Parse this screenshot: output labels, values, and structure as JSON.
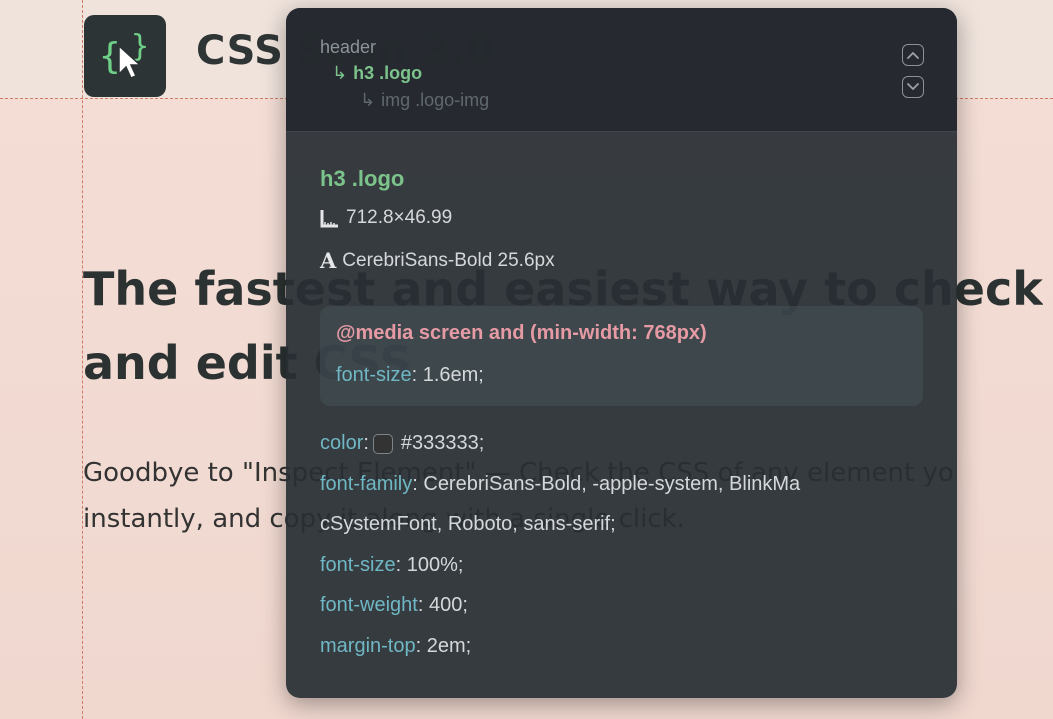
{
  "page": {
    "logo_text": "CSS Scan 3.0",
    "hero_title_line1": "The fastest and easiest way to check,",
    "hero_title_line2": "and edit CSS",
    "hero_sub_line1": "Goodbye to \"Inspect Element\" — Check the CSS of any element yo",
    "hero_sub_line2": "instantly, and copy it along with a single click."
  },
  "inspector": {
    "breadcrumb": {
      "parent": "header",
      "current": "h3 .logo",
      "child": "img .logo-img",
      "arrow": "↳"
    },
    "selected": {
      "name": "h3 .logo",
      "dimensions": "712.8×46.99",
      "font": "CerebriSans-Bold 25.6px",
      "font_icon": "A"
    },
    "media_rule": {
      "query": "@media screen and (min-width: 768px)",
      "decl_prop": "font-size",
      "decl_value": " 1.6em;"
    },
    "declarations": {
      "color_prop": "color",
      "color_value": "#333333;",
      "color_swatch": "#333333",
      "font_family_prop": "font-family",
      "font_family_value_1": " CerebriSans-Bold, -apple-system, BlinkMa",
      "font_family_value_2": "cSystemFont, Roboto, sans-serif;",
      "font_size_prop": "font-size",
      "font_size_value": " 100%;",
      "font_weight_prop": "font-weight",
      "font_weight_value": " 400;",
      "margin_top_prop": "margin-top",
      "margin_top_value": " 2em;"
    },
    "colors": {
      "selector_green": "#7cc38b",
      "media_pink": "#e59aa4",
      "property_teal": "#6fb7c4",
      "panel_bg": "#282e34"
    },
    "icons": {
      "up": "chevron-up-icon",
      "down": "chevron-down-icon",
      "ruler": "ruler-icon",
      "font": "font-icon"
    }
  }
}
